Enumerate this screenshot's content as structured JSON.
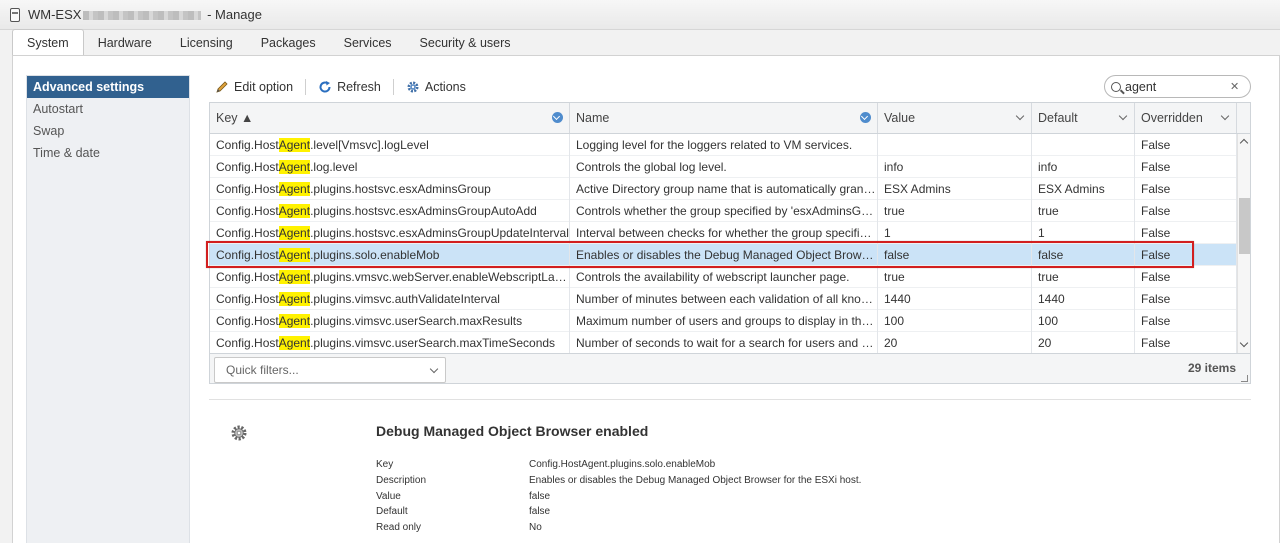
{
  "window": {
    "title_prefix": "WM-ESX",
    "title_suffix": " - Manage"
  },
  "tabs": [
    {
      "label": "System",
      "active": true
    },
    {
      "label": "Hardware"
    },
    {
      "label": "Licensing"
    },
    {
      "label": "Packages"
    },
    {
      "label": "Services"
    },
    {
      "label": "Security & users"
    }
  ],
  "sidebar": {
    "items": [
      {
        "label": "Advanced settings",
        "active": true
      },
      {
        "label": "Autostart"
      },
      {
        "label": "Swap"
      },
      {
        "label": "Time & date"
      }
    ]
  },
  "toolbar": {
    "edit_label": "Edit option",
    "refresh_label": "Refresh",
    "actions_label": "Actions"
  },
  "search": {
    "value": "agent",
    "clear_glyph": "✕"
  },
  "grid": {
    "columns": {
      "key": "Key ▲",
      "name": "Name",
      "value": "Value",
      "default": "Default",
      "overridden": "Overridden"
    },
    "highlight_term": "Agent",
    "rows": [
      {
        "key_pre": "Config.Host",
        "key_hl": "Agent",
        "key_post": ".level[Vmsvc].logLevel",
        "name": "Logging level for the loggers related to VM services.",
        "value": "",
        "default": "",
        "overridden": "False"
      },
      {
        "key_pre": "Config.Host",
        "key_hl": "Agent",
        "key_post": ".log.level",
        "name": "Controls the global log level.",
        "value": "info",
        "default": "info",
        "overridden": "False"
      },
      {
        "key_pre": "Config.Host",
        "key_hl": "Agent",
        "key_post": ".plugins.hostsvc.esxAdminsGroup",
        "name": "Active Directory group name that is automatically granted…",
        "value": "ESX Admins",
        "default": "ESX Admins",
        "overridden": "False"
      },
      {
        "key_pre": "Config.Host",
        "key_hl": "Agent",
        "key_post": ".plugins.hostsvc.esxAdminsGroupAutoAdd",
        "name": "Controls whether the group specified by 'esxAdminsGro…",
        "value": "true",
        "default": "true",
        "overridden": "False"
      },
      {
        "key_pre": "Config.Host",
        "key_hl": "Agent",
        "key_post": ".plugins.hostsvc.esxAdminsGroupUpdateInterval",
        "name": "Interval between checks for whether the group specified …",
        "value": "1",
        "default": "1",
        "overridden": "False"
      },
      {
        "key_pre": "Config.Host",
        "key_hl": "Agent",
        "key_post": ".plugins.solo.enableMob",
        "name": "Enables or disables the Debug Managed Object Browse…",
        "value": "false",
        "default": "false",
        "overridden": "False",
        "selected": true
      },
      {
        "key_pre": "Config.Host",
        "key_hl": "Agent",
        "key_post": ".plugins.vmsvc.webServer.enableWebscriptLauncher",
        "name": "Controls the availability of webscript launcher page.",
        "value": "true",
        "default": "true",
        "overridden": "False"
      },
      {
        "key_pre": "Config.Host",
        "key_hl": "Agent",
        "key_post": ".plugins.vimsvc.authValidateInterval",
        "name": "Number of minutes between each validation of all know…",
        "value": "1440",
        "default": "1440",
        "overridden": "False"
      },
      {
        "key_pre": "Config.Host",
        "key_hl": "Agent",
        "key_post": ".plugins.vimsvc.userSearch.maxResults",
        "name": "Maximum number of users and groups to display in the …",
        "value": "100",
        "default": "100",
        "overridden": "False"
      },
      {
        "key_pre": "Config.Host",
        "key_hl": "Agent",
        "key_post": ".plugins.vimsvc.userSearch.maxTimeSeconds",
        "name": "Number of seconds to wait for a search for users and gr…",
        "value": "20",
        "default": "20",
        "overridden": "False"
      }
    ],
    "quick_filters_placeholder": "Quick filters...",
    "item_count": "29 items"
  },
  "details": {
    "title": "Debug Managed Object Browser enabled",
    "fields": [
      {
        "label": "Key",
        "value": "Config.HostAgent.plugins.solo.enableMob"
      },
      {
        "label": "Description",
        "value": "Enables or disables the Debug Managed Object Browser for the ESXi host."
      },
      {
        "label": "Value",
        "value": "false"
      },
      {
        "label": "Default",
        "value": "false"
      },
      {
        "label": "Read only",
        "value": "No"
      }
    ]
  },
  "colors": {
    "nav_active": "#31618f",
    "row_selected": "#cbe3f7",
    "search_highlight": "#fff200",
    "annotation_box": "#d21f1f"
  }
}
